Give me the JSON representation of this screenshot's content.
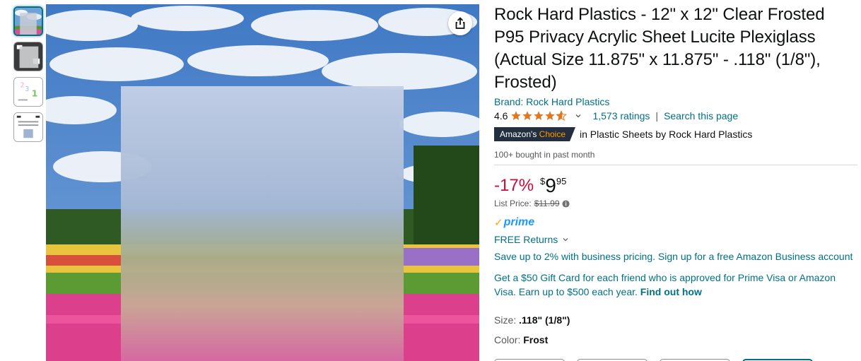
{
  "gallery": {
    "thumbnails": [
      {
        "name": "thumb-sky-field",
        "active": true
      },
      {
        "name": "thumb-frosted-sheet",
        "active": false
      },
      {
        "name": "thumb-size-numbers",
        "active": false
      },
      {
        "name": "thumb-spec-sheet",
        "active": false
      }
    ],
    "share_icon": "share-icon"
  },
  "product": {
    "title": "Rock Hard Plastics - 12\" x 12\" Clear Frosted P95 Privacy Acrylic Sheet Lucite Plexiglass (Actual Size 11.875\" x 11.875\" - .118\" (1/8\"), Frosted)",
    "brand_link": "Brand: Rock Hard Plastics",
    "rating_value": "4.6",
    "ratings_count": "1,573 ratings",
    "rating_separator": "|",
    "search_page": "Search this page",
    "badge_prefix": "Amazon's ",
    "badge_highlight": "Choice",
    "badge_category": "in Plastic Sheets by Rock Hard Plastics",
    "bought": "100+ bought in past month"
  },
  "pricing": {
    "discount": "-17%",
    "currency": "$",
    "whole": "9",
    "fraction": "95",
    "list_label": "List Price:",
    "list_value": "$11.99"
  },
  "delivery": {
    "prime_check": "✓",
    "prime_label": "prime",
    "free_returns": "FREE Returns",
    "business_offer": "Save up to 2% with business pricing. Sign up for a free Amazon Business account",
    "gift_offer": "Get a $50 Gift Card for each friend who is approved for Prime Visa or Amazon Visa. Earn up to $500 each year.",
    "gift_link": "Find out how"
  },
  "variations": {
    "size_label": "Size:",
    "size_value": ".118\" (1/8\")",
    "color_label": "Color:",
    "color_value": "Frost"
  },
  "colors": {
    "link": "#007185",
    "discount": "#cc0c39",
    "star": "#de7921",
    "badge_bg": "#232f3e",
    "badge_accent": "#ff9900",
    "prime": "#1a98ff"
  }
}
